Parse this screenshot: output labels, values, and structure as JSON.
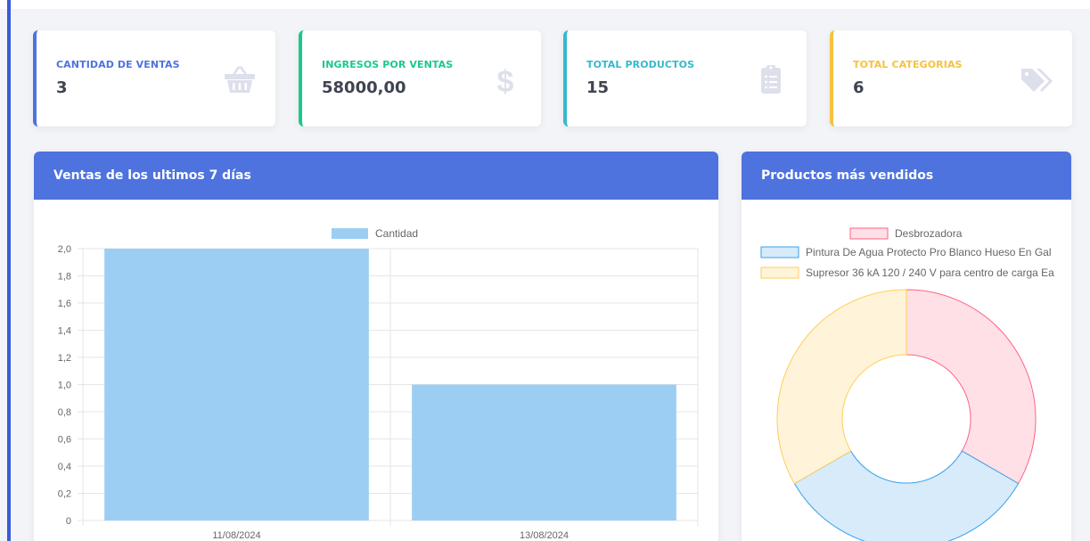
{
  "colors": {
    "sales_accent": "#4e73df",
    "income_accent": "#1cc88a",
    "products_accent": "#36b9cc",
    "categories_accent": "#f6c23e",
    "header_bg": "#4e73df",
    "icon_gray": "#dddfeb"
  },
  "cards": [
    {
      "label": "CANTIDAD DE VENTAS",
      "value": "3",
      "icon": "basket-icon"
    },
    {
      "label": "INGRESOS POR VENTAS",
      "value": "58000,00",
      "icon": "dollar-icon"
    },
    {
      "label": "TOTAL PRODUCTOS",
      "value": "15",
      "icon": "clipboard-list-icon"
    },
    {
      "label": "TOTAL CATEGORIAS",
      "value": "6",
      "icon": "tags-icon"
    }
  ],
  "sales_panel": {
    "title": "Ventas de los ultimos 7 días"
  },
  "products_panel": {
    "title": "Productos más vendidos"
  },
  "chart_data": [
    {
      "type": "bar",
      "categories": [
        "11/08/2024",
        "13/08/2024"
      ],
      "series": [
        {
          "name": "Cantidad",
          "values": [
            2,
            1
          ]
        }
      ],
      "ylim": [
        0,
        2
      ],
      "yticks": [
        "0",
        "0,2",
        "0,4",
        "0,6",
        "0,8",
        "1,0",
        "1,2",
        "1,4",
        "1,6",
        "1,8",
        "2,0"
      ],
      "legend_position": "top",
      "grid": true,
      "bar_color": "#9ccef3"
    },
    {
      "type": "pie",
      "variant": "doughnut",
      "labels": [
        "Desbrozadora",
        "Pintura De Agua Protecto Pro Blanco Hueso En Gal",
        "Supresor 36 kA 120 / 240 V para centro de carga Ea"
      ],
      "values": [
        1,
        1,
        1
      ],
      "fill_colors": [
        "#ffe0e6",
        "#d7ebfa",
        "#fff4d9"
      ],
      "border_colors": [
        "#ff6384",
        "#36a2eb",
        "#ffce56"
      ],
      "legend_position": "top"
    }
  ]
}
